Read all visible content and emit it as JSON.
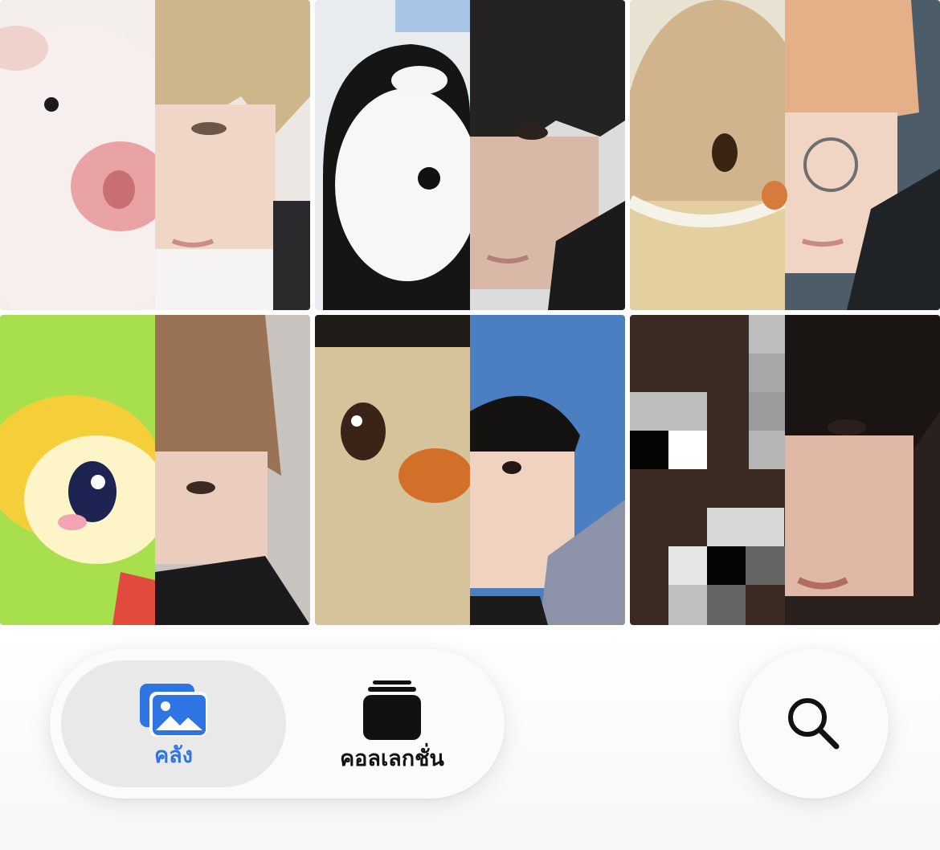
{
  "tabbar": {
    "library_label": "คลัง",
    "collections_label": "คอลเลกชั่น",
    "selected": "library",
    "accent_color": "#2f74e3"
  },
  "search": {
    "icon": "magnifying-glass-icon"
  },
  "photos": [
    {
      "left_half": "piglet",
      "right_half": "person-light-hair"
    },
    {
      "left_half": "orca-plush",
      "right_half": "person-dark-hair"
    },
    {
      "left_half": "teddy-bear",
      "right_half": "person-glasses"
    },
    {
      "left_half": "cartoon-yellow-creature",
      "right_half": "person-brown-hair"
    },
    {
      "left_half": "fuzzy-plush-orange-nose",
      "right_half": "child"
    },
    {
      "left_half": "pixel-art-face",
      "right_half": "person-close-up"
    }
  ]
}
